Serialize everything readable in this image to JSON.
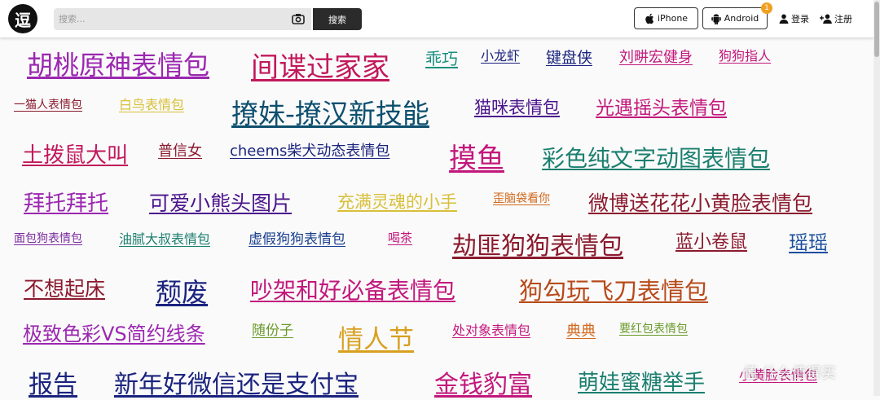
{
  "header": {
    "logo_char": "逗",
    "search": {
      "placeholder": "搜索...",
      "button_label": "搜索"
    },
    "iphone_label": "iPhone",
    "android_label": "Android",
    "notify_count": "1",
    "login_label": "登录",
    "register_label": "注册"
  },
  "tags": [
    {
      "label": "胡桃原神表情包",
      "color": "#9b27b0"
    },
    {
      "label": "间谍过家家",
      "color": "#c2185b"
    },
    {
      "label": "乖巧",
      "color": "#1b8f7f"
    },
    {
      "label": "小龙虾",
      "color": "#1a237e"
    },
    {
      "label": "键盘侠",
      "color": "#1a237e"
    },
    {
      "label": "刘畊宏健身",
      "color": "#c2187c"
    },
    {
      "label": "狗狗指人",
      "color": "#c2187c"
    },
    {
      "label": "一猫人表情包",
      "color": "#8b1a2e"
    },
    {
      "label": "白鸟表情包",
      "color": "#d8c03a"
    },
    {
      "label": "撩妹-撩汉新技能",
      "color": "#0d4f6e"
    },
    {
      "label": "猫咪表情包",
      "color": "#4a148c"
    },
    {
      "label": "光遇摇头表情包",
      "color": "#c2187c"
    },
    {
      "label": "土拨鼠大叫",
      "color": "#c2185b"
    },
    {
      "label": "普信女",
      "color": "#8b1a2e"
    },
    {
      "label": "cheems柴犬动态表情包",
      "color": "#1a237e"
    },
    {
      "label": "摸鱼",
      "color": "#c2187c"
    },
    {
      "label": "彩色纯文字动图表情包",
      "color": "#1b7f6f"
    },
    {
      "label": "拜托拜托",
      "color": "#9b27b0"
    },
    {
      "label": "可爱小熊头图片",
      "color": "#4a148c"
    },
    {
      "label": "充满灵魂的小手",
      "color": "#d8c03a"
    },
    {
      "label": "歪脑袋看你",
      "color": "#d2691e"
    },
    {
      "label": "微博送花花小黄脸表情包",
      "color": "#8b1a2e"
    },
    {
      "label": "面包狗表情包",
      "color": "#7b2aa0"
    },
    {
      "label": "油腻大叔表情包",
      "color": "#1b7f6f"
    },
    {
      "label": "虚假狗狗表情包",
      "color": "#1a3f8e"
    },
    {
      "label": "喝茶",
      "color": "#c2187c"
    },
    {
      "label": "劫匪狗狗表情包",
      "color": "#8b1a2e"
    },
    {
      "label": "蓝小卷鼠",
      "color": "#8b1a2e"
    },
    {
      "label": "瑶瑶",
      "color": "#1a4f9e"
    },
    {
      "label": "不想起床",
      "color": "#8b1a2e"
    },
    {
      "label": "颓废",
      "color": "#1a237e"
    },
    {
      "label": "吵架和好必备表情包",
      "color": "#c2187c"
    },
    {
      "label": "狗勾玩飞刀表情包",
      "color": "#b84a1a"
    },
    {
      "label": "极致色彩VS简约线条",
      "color": "#9b27b0"
    },
    {
      "label": "随份子",
      "color": "#6a9a2a"
    },
    {
      "label": "情人节",
      "color": "#d8a020"
    },
    {
      "label": "处对象表情包",
      "color": "#c2187c"
    },
    {
      "label": "典典",
      "color": "#d2691e"
    },
    {
      "label": "要红包表情包",
      "color": "#6a9a2a"
    },
    {
      "label": "报告",
      "color": "#1a237e"
    },
    {
      "label": "新年好微信还是支付宝",
      "color": "#1a237e"
    },
    {
      "label": "金钱豹富",
      "color": "#c2187c"
    },
    {
      "label": "萌娃蜜糖举手",
      "color": "#1b7f6f"
    },
    {
      "label": "小黄脸表情包",
      "color": "#c2187c"
    }
  ],
  "watermark": "值 什么值得买"
}
